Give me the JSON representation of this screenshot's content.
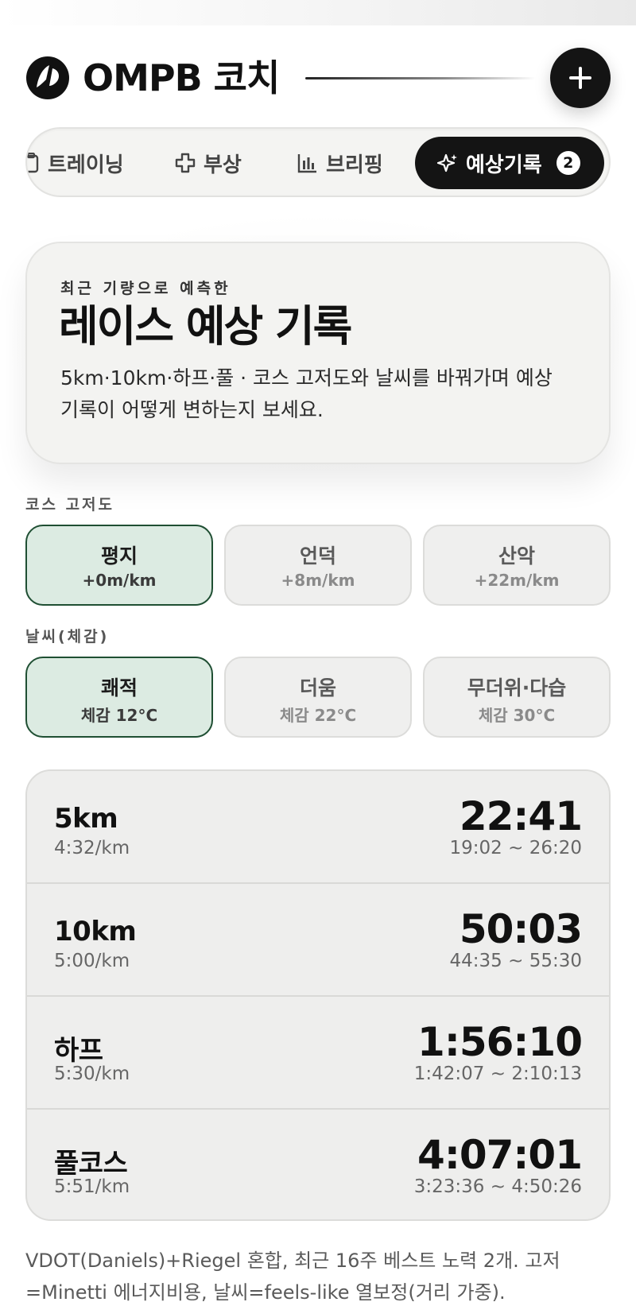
{
  "header": {
    "brand": "OMPB 코치"
  },
  "tabs": [
    {
      "label": "트레이닝",
      "icon": "clipboard-icon"
    },
    {
      "label": "부상",
      "icon": "medical-cross-icon"
    },
    {
      "label": "브리핑",
      "icon": "bar-chart-icon"
    },
    {
      "label": "예상기록",
      "icon": "sparkle-icon",
      "badge": "2",
      "active": true
    }
  ],
  "hero": {
    "kicker": "최근 기량으로 예측한",
    "title": "레이스 예상 기록",
    "description": "5km·10km·하프·풀 · 코스 고저도와 날씨를 바꿔가며 예상 기록이 어떻게 변하는지 보세요."
  },
  "elevation": {
    "label": "코스 고저도",
    "options": [
      {
        "title": "평지",
        "sub": "+0m/km",
        "selected": true
      },
      {
        "title": "언덕",
        "sub": "+8m/km",
        "selected": false
      },
      {
        "title": "산악",
        "sub": "+22m/km",
        "selected": false
      }
    ]
  },
  "weather": {
    "label": "날씨(체감)",
    "options": [
      {
        "title": "쾌적",
        "sub": "체감 12°C",
        "selected": true
      },
      {
        "title": "더움",
        "sub": "체감 22°C",
        "selected": false
      },
      {
        "title": "무더위·다습",
        "sub": "체감 30°C",
        "selected": false
      }
    ]
  },
  "results": [
    {
      "distance": "5km",
      "pace": "4:32/km",
      "time": "22:41",
      "range": "19:02 ~ 26:20"
    },
    {
      "distance": "10km",
      "pace": "5:00/km",
      "time": "50:03",
      "range": "44:35 ~ 55:30"
    },
    {
      "distance": "하프",
      "pace": "5:30/km",
      "time": "1:56:10",
      "range": "1:42:07 ~ 2:10:13"
    },
    {
      "distance": "풀코스",
      "pace": "5:51/km",
      "time": "4:07:01",
      "range": "3:23:36 ~ 4:50:26"
    }
  ],
  "footnote": "VDOT(Daniels)+Riegel 혼합, 최근 16주 베스트 노력 2개. 고저=Minetti 에너지비용, 날씨=feels-like 열보정(거리 가중).",
  "colors": {
    "accent_dark": "#141414",
    "selected_bg": "#dcebe2",
    "selected_border": "#1f4f33"
  }
}
